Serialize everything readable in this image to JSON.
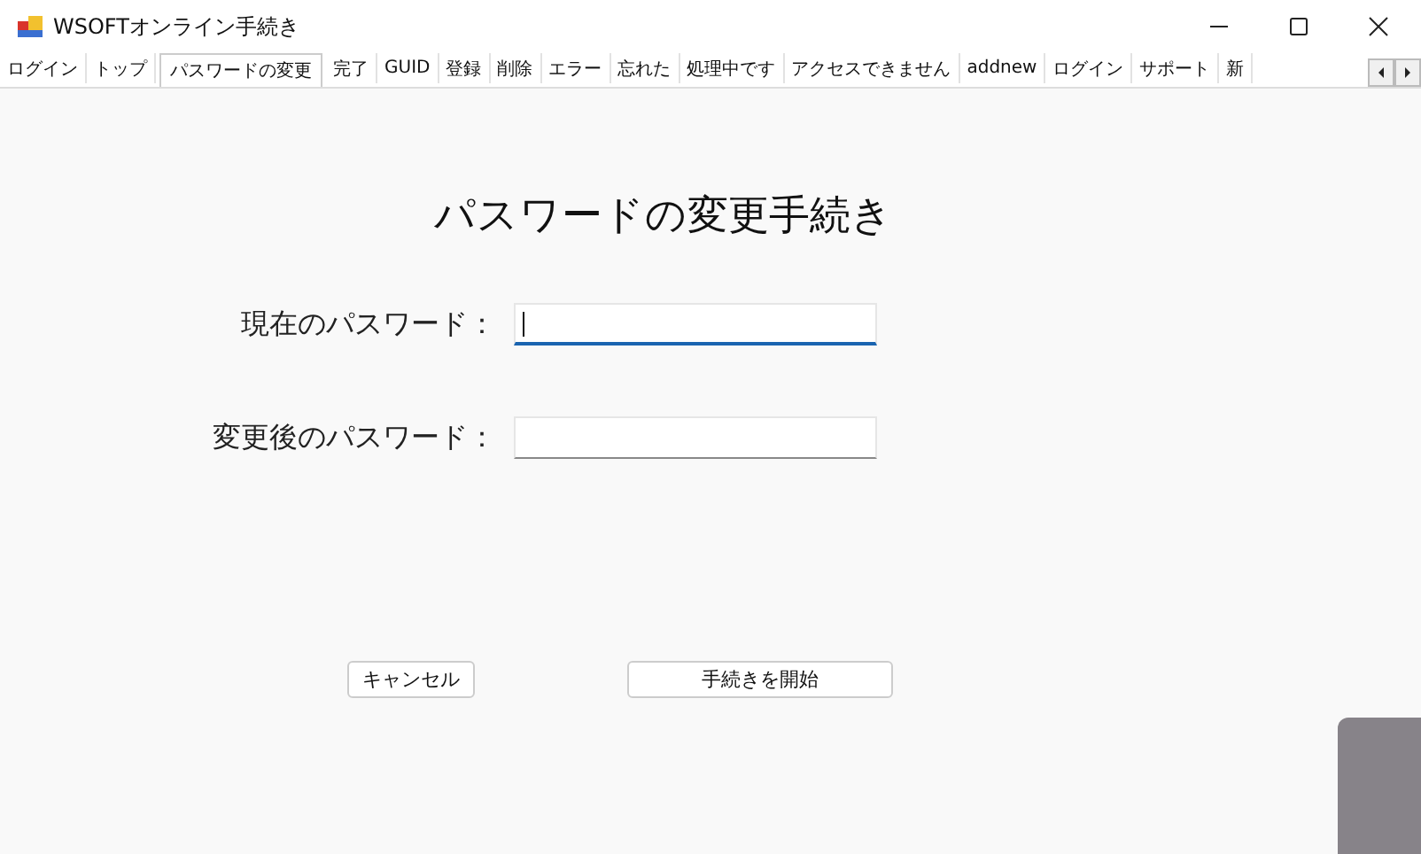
{
  "window": {
    "title": "WSOFTオンライン手続き"
  },
  "tabs": [
    {
      "label": "ログイン",
      "selected": false
    },
    {
      "label": "トップ",
      "selected": false
    },
    {
      "label": "パスワードの変更",
      "selected": true
    },
    {
      "label": "完了",
      "selected": false
    },
    {
      "label": "GUID",
      "selected": false
    },
    {
      "label": "登録",
      "selected": false
    },
    {
      "label": "削除",
      "selected": false
    },
    {
      "label": "エラー",
      "selected": false
    },
    {
      "label": "忘れた",
      "selected": false
    },
    {
      "label": "処理中です",
      "selected": false
    },
    {
      "label": "アクセスできません",
      "selected": false
    },
    {
      "label": "addnew",
      "selected": false
    },
    {
      "label": "ログイン",
      "selected": false
    },
    {
      "label": "サポート",
      "selected": false
    },
    {
      "label": "新",
      "selected": false
    }
  ],
  "heading": "パスワードの変更手続き",
  "fields": [
    {
      "label": "現在のパスワード：",
      "focused": true
    },
    {
      "label": "変更後のパスワード：",
      "focused": false
    }
  ],
  "buttons": {
    "cancel": "キャンセル",
    "start": "手続きを開始"
  }
}
